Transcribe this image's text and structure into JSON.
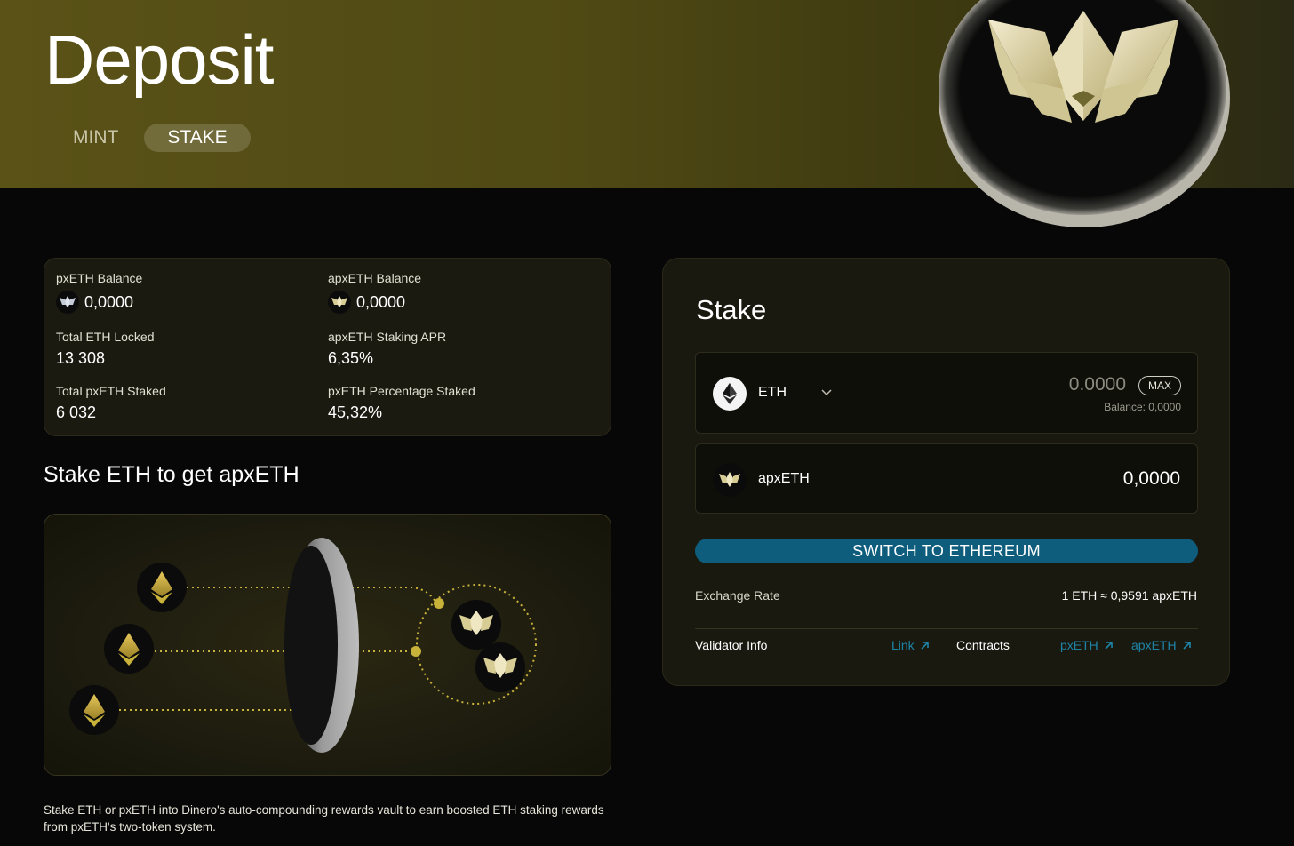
{
  "header": {
    "title": "Deposit",
    "tabs": [
      {
        "label": "MINT",
        "active": false
      },
      {
        "label": "STAKE",
        "active": true
      }
    ]
  },
  "stats": {
    "px_balance": {
      "label": "pxETH Balance",
      "value": "0,0000"
    },
    "apx_balance": {
      "label": "apxETH Balance",
      "value": "0,0000"
    },
    "total_eth_locked": {
      "label": "Total ETH Locked",
      "value": "13 308"
    },
    "apx_staking_apr": {
      "label": "apxETH Staking APR",
      "value": "6,35%"
    },
    "total_px_staked": {
      "label": "Total pxETH Staked",
      "value": "6 032"
    },
    "px_percentage_staked": {
      "label": "pxETH Percentage Staked",
      "value": "45,32%"
    }
  },
  "section_title": "Stake ETH to get apxETH",
  "description": "Stake ETH or pxETH into Dinero's auto-compounding rewards vault to earn boosted ETH staking rewards from pxETH's two-token system.",
  "stake": {
    "title": "Stake",
    "input": {
      "token": "ETH",
      "placeholder": "0.0000",
      "max_label": "MAX",
      "balance": "Balance: 0,0000"
    },
    "output": {
      "token": "apxETH",
      "value": "0,0000"
    },
    "switch_button": "SWITCH TO ETHEREUM",
    "exchange_rate_label": "Exchange Rate",
    "exchange_rate_value": "1 ETH ≈ 0,9591 apxETH",
    "validator_info_label": "Validator Info",
    "validator_link": "Link",
    "contracts_label": "Contracts",
    "contract_links": [
      "pxETH",
      "apxETH"
    ]
  },
  "colors": {
    "accent_gold": "#c9b23a",
    "button_blue": "#0e5d7d",
    "link_blue": "#1d84a8"
  }
}
